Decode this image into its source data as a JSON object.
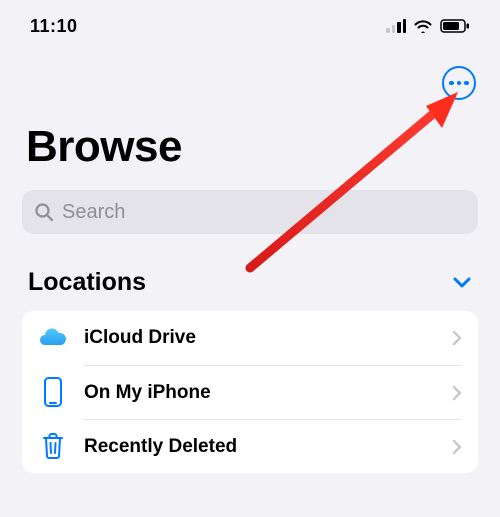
{
  "status": {
    "time": "11:10"
  },
  "header": {
    "title": "Browse"
  },
  "search": {
    "placeholder": "Search",
    "value": ""
  },
  "section": {
    "title": "Locations",
    "items": [
      {
        "label": "iCloud Drive"
      },
      {
        "label": "On My iPhone"
      },
      {
        "label": "Recently Deleted"
      }
    ]
  },
  "colors": {
    "accent": "#007aff",
    "trash": "#0a84ff",
    "cloud": "#5ac8fa"
  }
}
